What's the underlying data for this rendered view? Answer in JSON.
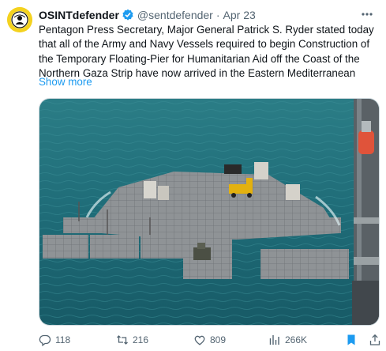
{
  "author": {
    "display_name": "OSINTdefender",
    "handle": "@sentdefender",
    "separator": "·",
    "date": "Apr 23"
  },
  "tweet": {
    "text": "Pentagon Press Secretary, Major General Patrick S. Ryder stated today that all of the Army and Navy Vessels required to begin Construction of the Temporary Floating-Pier for Humanitarian Aid off the Coast of the Northern Gaza Strip have now arrived in the Eastern Mediterranean",
    "show_more": "Show more"
  },
  "actions": {
    "replies": "118",
    "reposts": "216",
    "likes": "809",
    "views": "266K"
  },
  "colors": {
    "accent": "#1d9bf0",
    "muted": "#536471",
    "sea": "#1f6b7a"
  },
  "icons": [
    "verified-badge-icon",
    "more-icon",
    "reply-icon",
    "repost-icon",
    "like-icon",
    "views-icon",
    "bookmark-icon",
    "share-icon"
  ]
}
